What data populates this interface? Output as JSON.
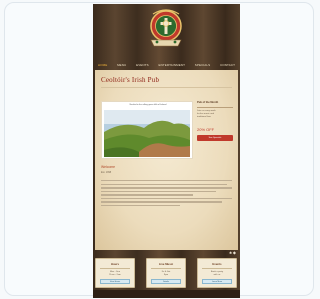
{
  "site": {
    "page_title": "Ceoltóir's Irish Pub",
    "nav": [
      {
        "label": "HOME",
        "active": true
      },
      {
        "label": "MENU",
        "active": false
      },
      {
        "label": "EVENTS",
        "active": false
      },
      {
        "label": "ENTERTAINMENT",
        "active": false
      },
      {
        "label": "SPECIALS",
        "active": false
      },
      {
        "label": "CONTACT",
        "active": false
      }
    ],
    "photo_caption": "Nestled in the rolling green hills of Ireland",
    "sidebar": {
      "heading": "Pub of the Month",
      "text": [
        "Join us every week",
        "for live music and",
        "traditional fare"
      ],
      "promo": "20% OFF",
      "button": "See Specials"
    },
    "section_heading": "Welcome",
    "section_sub": "Est. 1998",
    "footer_strip_icons": "♣ ◆",
    "boxes": [
      {
        "heading": "Hours",
        "text": [
          "Mon - Sun",
          "11am - 2am"
        ],
        "button": "View Hours"
      },
      {
        "heading": "Live Music",
        "text": [
          "Fri & Sat",
          "9pm"
        ],
        "button": "Details"
      },
      {
        "heading": "Events",
        "text": [
          "Book a party",
          "with us"
        ],
        "button": "Learn More"
      }
    ]
  },
  "colors": {
    "accent_red": "#c0392b",
    "title_red": "#8c1f14",
    "nav_active": "#f0b23a",
    "wood_dark": "#3a2a1c"
  }
}
